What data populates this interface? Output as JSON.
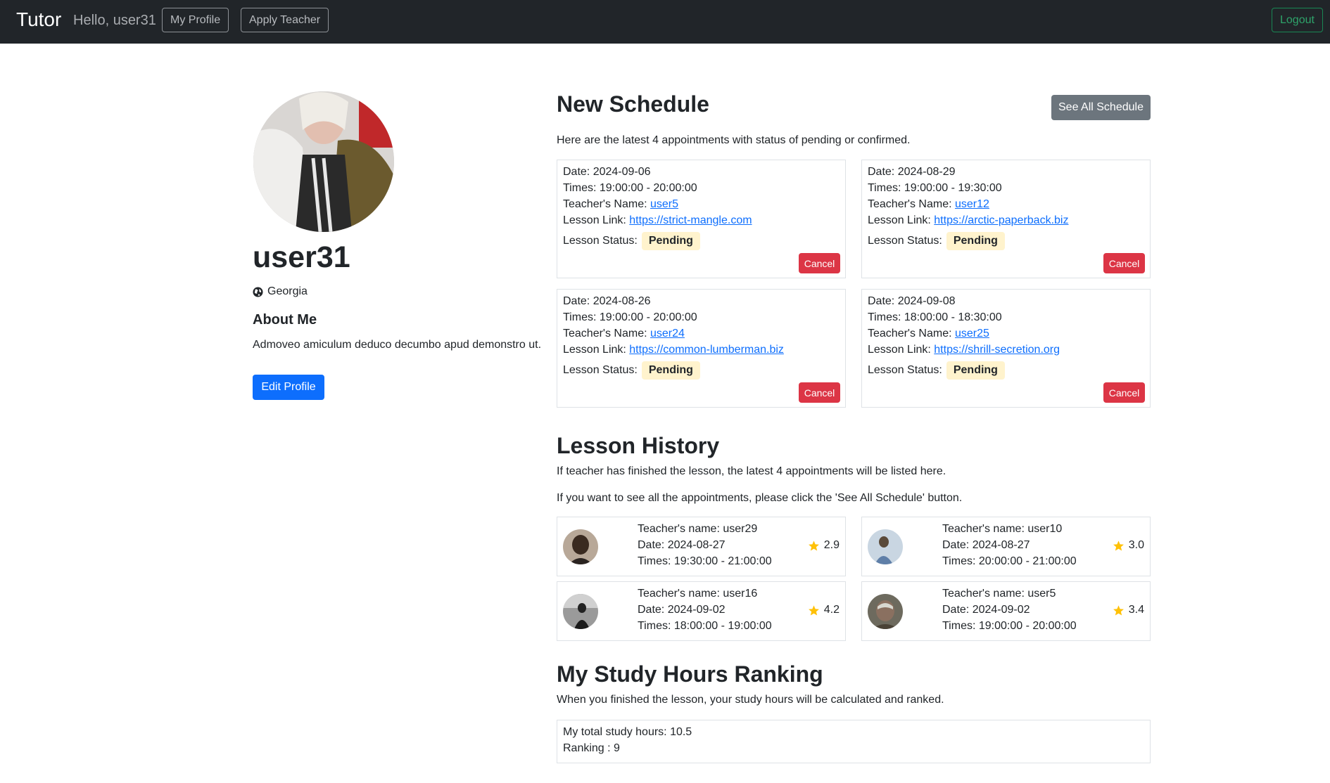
{
  "navbar": {
    "brand": "Tutor",
    "greeting": "Hello, user31",
    "my_profile": "My Profile",
    "apply_teacher": "Apply Teacher",
    "logout": "Logout"
  },
  "profile": {
    "username": "user31",
    "country": "Georgia",
    "about_title": "About Me",
    "about_text": "Admoveo amiculum deduco decumbo apud demonstro ut.",
    "edit_button": "Edit Profile"
  },
  "schedule": {
    "title": "New Schedule",
    "see_all": "See All Schedule",
    "description": "Here are the latest 4 appointments with status of pending or confirmed.",
    "status_label": "Lesson Status:",
    "cancel_label": "Cancel",
    "items": [
      {
        "date": "Date: 2024-09-06",
        "times": "Times: 19:00:00 - 20:00:00",
        "teacher_label": "Teacher's Name: ",
        "teacher": "user5",
        "link_label": "Lesson Link: ",
        "link": "https://strict-mangle.com",
        "status": "Pending"
      },
      {
        "date": "Date: 2024-08-29",
        "times": "Times: 19:00:00 - 19:30:00",
        "teacher_label": "Teacher's Name: ",
        "teacher": "user12",
        "link_label": "Lesson Link: ",
        "link": "https://arctic-paperback.biz",
        "status": "Pending"
      },
      {
        "date": "Date: 2024-08-26",
        "times": "Times: 19:00:00 - 20:00:00",
        "teacher_label": "Teacher's Name: ",
        "teacher": "user24",
        "link_label": "Lesson Link: ",
        "link": "https://common-lumberman.biz",
        "status": "Pending"
      },
      {
        "date": "Date: 2024-09-08",
        "times": "Times: 18:00:00 - 18:30:00",
        "teacher_label": "Teacher's Name: ",
        "teacher": "user25",
        "link_label": "Lesson Link: ",
        "link": "https://shrill-secretion.org",
        "status": "Pending"
      }
    ]
  },
  "history": {
    "title": "Lesson History",
    "description1": "If teacher has finished the lesson, the latest 4 appointments will be listed here.",
    "description2": "If you want to see all the appointments, please click the 'See All Schedule' button.",
    "items": [
      {
        "teacher": "Teacher's name: user29",
        "date": "Date: 2024-08-27",
        "times": "Times: 19:30:00 - 21:00:00",
        "rating": "2.9"
      },
      {
        "teacher": "Teacher's name: user10",
        "date": "Date: 2024-08-27",
        "times": "Times: 20:00:00 - 21:00:00",
        "rating": "3.0"
      },
      {
        "teacher": "Teacher's name: user16",
        "date": "Date: 2024-09-02",
        "times": "Times: 18:00:00 - 19:00:00",
        "rating": "4.2"
      },
      {
        "teacher": "Teacher's name: user5",
        "date": "Date: 2024-09-02",
        "times": "Times: 19:00:00 - 20:00:00",
        "rating": "3.4"
      }
    ]
  },
  "ranking": {
    "title": "My Study Hours Ranking",
    "description": "When you finished the lesson, your study hours will be calculated and ranked.",
    "total_hours": "My total study hours: 10.5",
    "ranking": "Ranking : 9"
  },
  "colors": {
    "navbar": "#212529",
    "primary": "#0d6efd",
    "secondary": "#6c757d",
    "danger": "#dc3545",
    "success": "#198754",
    "warning_bg": "#fff3cd",
    "star": "#ffc107"
  }
}
